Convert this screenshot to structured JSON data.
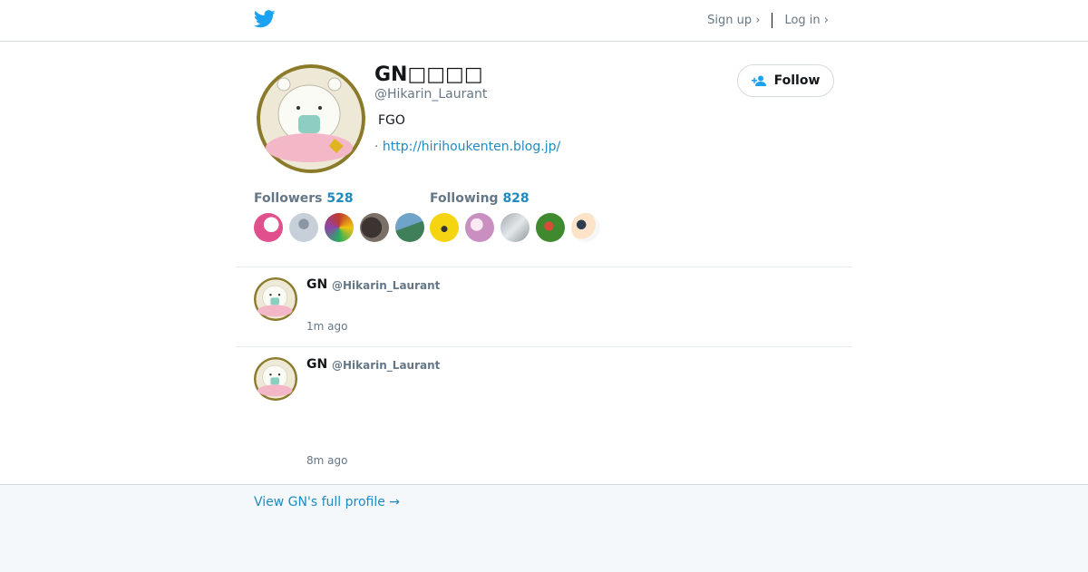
{
  "header": {
    "signup_label": "Sign up ›",
    "login_label": "Log in ›"
  },
  "profile": {
    "name": "GN□□□□",
    "handle": "@Hikarin_Laurant",
    "bio": "FGO",
    "url_prefix": "·",
    "url": "http://hirihoukenten.blog.jp/",
    "follow_label": "Follow",
    "followers_label": "Followers",
    "followers_count": "528",
    "following_label": "Following",
    "following_count": "828"
  },
  "tweets": [
    {
      "name": "GN",
      "handle": "@Hikarin_Laurant",
      "time": "1m ago"
    },
    {
      "name": "GN",
      "handle": "@Hikarin_Laurant",
      "time": "8m ago"
    }
  ],
  "footer": {
    "full_profile_label": "View GN's full profile →"
  },
  "colors": {
    "link": "#1f8ac0",
    "muted": "#657786",
    "brand": "#1da1f2"
  },
  "icons": {
    "logo": "twitter-bird-icon",
    "follow": "add-user-icon"
  }
}
